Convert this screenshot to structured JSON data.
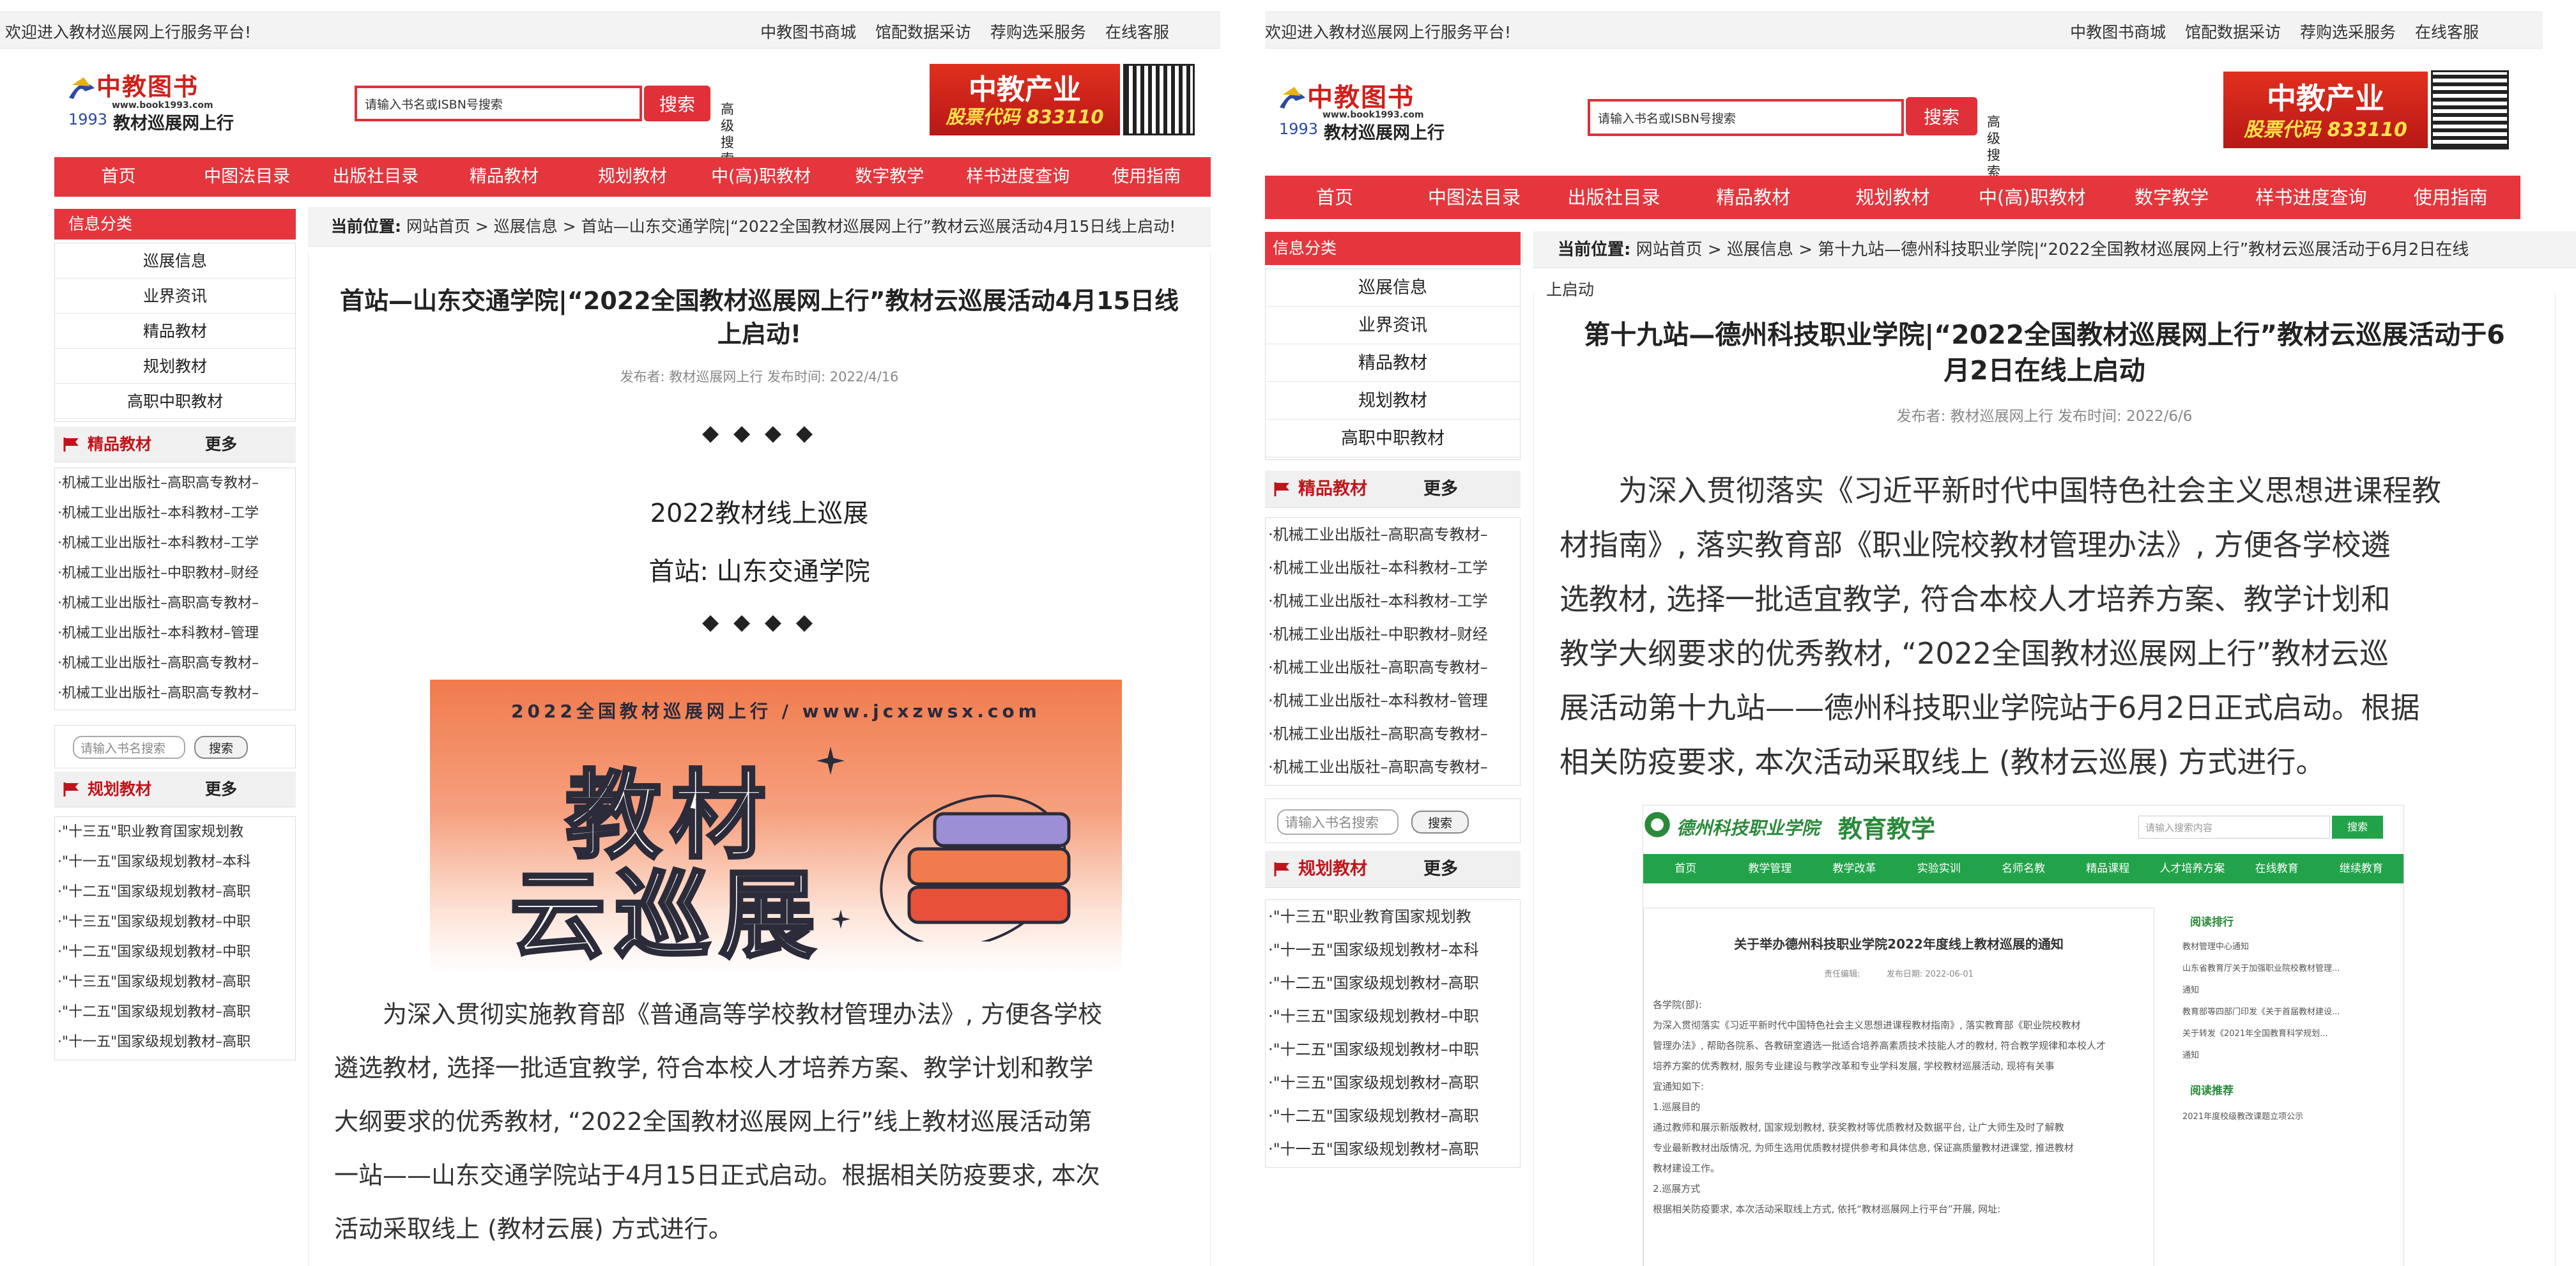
{
  "left": {
    "top_bar": {
      "welcome": "欢迎进入教材巡展网上行服务平台!",
      "links": [
        "中教图书商城",
        "馆配数据采访",
        "荐购选采服务",
        "在线客服"
      ]
    },
    "logo": {
      "brand": "中教图书",
      "url": "www.book1993.com",
      "year": "1993",
      "sub": "教材巡展网上行"
    },
    "search": {
      "placeholder": "请输入书名或ISBN号搜索",
      "button": "搜索",
      "advanced": "高级搜索"
    },
    "banner": {
      "line1": "中教产业",
      "line2": "股票代码 833110"
    },
    "nav": [
      "首页",
      "中图法目录",
      "出版社目录",
      "精品教材",
      "规划教材",
      "中(高)职教材",
      "数字教学",
      "样书进度查询",
      "使用指南"
    ],
    "sidebar": {
      "info_title": "信息分类",
      "info_items": [
        "巡展信息",
        "业界资讯",
        "精品教材",
        "规划教材",
        "高职中职教材"
      ],
      "quality": {
        "title": "精品教材",
        "more": "更多",
        "items": [
          "·机械工业出版社–高职高专教材–",
          "·机械工业出版社–本科教材–工学",
          "·机械工业出版社–本科教材–工学",
          "·机械工业出版社–中职教材–财经",
          "·机械工业出版社–高职高专教材–",
          "·机械工业出版社–本科教材–管理",
          "·机械工业出版社–高职高专教材–",
          "·机械工业出版社–高职高专教材–"
        ]
      },
      "mini_search": {
        "placeholder": "请输入书名搜索",
        "button": "搜索"
      },
      "planned": {
        "title": "规划教材",
        "more": "更多",
        "items": [
          "·\"十三五\"职业教育国家规划教",
          "·\"十一五\"国家级规划教材–本科",
          "·\"十二五\"国家级规划教材–高职",
          "·\"十三五\"国家级规划教材–中职",
          "·\"十二五\"国家级规划教材–中职",
          "·\"十三五\"国家级规划教材–高职",
          "·\"十二五\"国家级规划教材–高职",
          "·\"十一五\"国家级规划教材–高职"
        ]
      }
    },
    "breadcrumb": {
      "label": "当前位置:",
      "path": "网站首页 > 巡展信息 > 首站—山东交通学院|“2022全国教材巡展网上行”教材云巡展活动4月15日线上启动!"
    },
    "article": {
      "title_l1": "首站—山东交通学院|“2022全国教材巡展网上行”教材云巡展活动4月15日线",
      "title_l2": "上启动!",
      "meta": "发布者: 教材巡展网上行 发布时间: 2022/4/16",
      "diamonds": "◆ ◆ ◆ ◆",
      "heading": "2022教材线上巡展",
      "subheading": "首站: 山东交通学院",
      "cover_caption": "2022全国教材巡展网上行 / www.jcxzwsx.com",
      "cover_big1": "教材",
      "cover_big2": "云巡展",
      "para_lines": [
        "为深入贯彻实施教育部《普通高等学校教材管理办法》, 方便各学校",
        "遴选教材, 选择一批适宜教学, 符合本校人才培养方案、教学计划和教学",
        "大纲要求的优秀教材, “2022全国教材巡展网上行”线上教材巡展活动第",
        "一站——山东交通学院站于4月15日正式启动。根据相关防疫要求, 本次",
        "活动采取线上 (教材云展) 方式进行。"
      ]
    }
  },
  "right": {
    "top_bar": {
      "welcome": "欢迎进入教材巡展网上行服务平台!",
      "links": [
        "中教图书商城",
        "馆配数据采访",
        "荐购选采服务",
        "在线客服"
      ]
    },
    "logo": {
      "brand": "中教图书",
      "url": "www.book1993.com",
      "year": "1993",
      "sub": "教材巡展网上行"
    },
    "search": {
      "placeholder": "请输入书名或ISBN号搜索",
      "button": "搜索",
      "advanced": "高级搜索"
    },
    "banner": {
      "line1": "中教产业",
      "line2": "股票代码 833110"
    },
    "nav": [
      "首页",
      "中图法目录",
      "出版社目录",
      "精品教材",
      "规划教材",
      "中(高)职教材",
      "数字教学",
      "样书进度查询",
      "使用指南"
    ],
    "sidebar": {
      "info_title": "信息分类",
      "info_items": [
        "巡展信息",
        "业界资讯",
        "精品教材",
        "规划教材",
        "高职中职教材"
      ],
      "quality": {
        "title": "精品教材",
        "more": "更多",
        "items": [
          "·机械工业出版社–高职高专教材–",
          "·机械工业出版社–本科教材–工学",
          "·机械工业出版社–本科教材–工学",
          "·机械工业出版社–中职教材–财经",
          "·机械工业出版社–高职高专教材–",
          "·机械工业出版社–本科教材–管理",
          "·机械工业出版社–高职高专教材–",
          "·机械工业出版社–高职高专教材–"
        ]
      },
      "mini_search": {
        "placeholder": "请输入书名搜索",
        "button": "搜索"
      },
      "planned": {
        "title": "规划教材",
        "more": "更多",
        "items": [
          "·\"十三五\"职业教育国家规划教",
          "·\"十一五\"国家级规划教材–本科",
          "·\"十二五\"国家级规划教材–高职",
          "·\"十三五\"国家级规划教材–中职",
          "·\"十二五\"国家级规划教材–中职",
          "·\"十三五\"国家级规划教材–高职",
          "·\"十二五\"国家级规划教材–高职",
          "·\"十一五\"国家级规划教材–高职"
        ]
      }
    },
    "breadcrumb": {
      "label": "当前位置:",
      "path": "网站首页 > 巡展信息 > 第十九站—德州科技职业学院|“2022全国教材巡展网上行”教材云巡展活动于6月2日在线",
      "wrap": "上启动"
    },
    "article": {
      "title_l1": "第十九站—德州科技职业学院|“2022全国教材巡展网上行”教材云巡展活动于6",
      "title_l2": "月2日在线上启动",
      "meta": "发布者: 教材巡展网上行 发布时间: 2022/6/6",
      "para_lines": [
        "为深入贯彻落实《习近平新时代中国特色社会主义思想进课程教",
        "材指南》, 落实教育部《职业院校教材管理办法》, 方便各学校遴",
        "选教材, 选择一批适宜教学, 符合本校人才培养方案、教学计划和",
        "教学大纲要求的优秀教材, “2022全国教材巡展网上行”教材云巡",
        "展活动第十九站——德州科技职业学院站于6月2日正式启动。根据",
        "相关防疫要求, 本次活动采取线上 (教材云巡展) 方式进行。"
      ],
      "screenshot": {
        "site_name": "德州科技职业学院",
        "section": "教育教学",
        "search_placeholder": "请输入搜索内容",
        "search_button": "搜索",
        "nav": [
          "首页",
          "教学管理",
          "教学改革",
          "实验实训",
          "名师名教",
          "精品课程",
          "人才培养方案",
          "在线教育",
          "继续教育"
        ],
        "notice_title": "关于举办德州科技职业学院2022年度线上教材巡展的通知",
        "notice_meta": "责任编辑:          发布日期: 2022-06-01",
        "body_lines": [
          "各学院(部):",
          "为深入贯彻落实《习近平新时代中国特色社会主义思想进课程教材指南》, 落实教育部《职业院校教材",
          "管理办法》, 帮助各院系、各教研室遴选一批适合培养高素质技术技能人才的教材, 符合教学规律和本校人才",
          "培养方案的优秀教材, 服务专业建设与教学改革和专业学科发展, 学校教材巡展活动, 现将有关事",
          "宜通知如下:",
          "1.巡展目的",
          "通过教师和展示新版教材, 国家规划教材, 获奖教材等优质教材及数据平台, 让广大师生及时了解教",
          "专业最新教材出版情况, 为师生选用优质教材提供参考和具体信息, 保证高质量教材进课堂, 推进教材",
          "教材建设工作。",
          "2.巡展方式",
          "根据相关防疫要求, 本次活动采取线上方式, 依托“教材巡展网上行平台”开展, 网址:"
        ],
        "aside1_title": "阅读排行",
        "aside1_items": [
          "教材管理中心通知",
          "山东省教育厅关于加强职业院校教材管理...",
          "通知",
          "教育部等四部门印发《关于首届教材建设...",
          "关于转发《2021年全国教育科学规划...",
          "通知"
        ],
        "aside2_title": "阅读推荐",
        "aside2_items": [
          "2021年度校级教改课题立项公示"
        ]
      }
    }
  },
  "colors": {
    "accent_red": "#e5363d",
    "title_red": "#c0141b",
    "green": "#22a34a"
  }
}
